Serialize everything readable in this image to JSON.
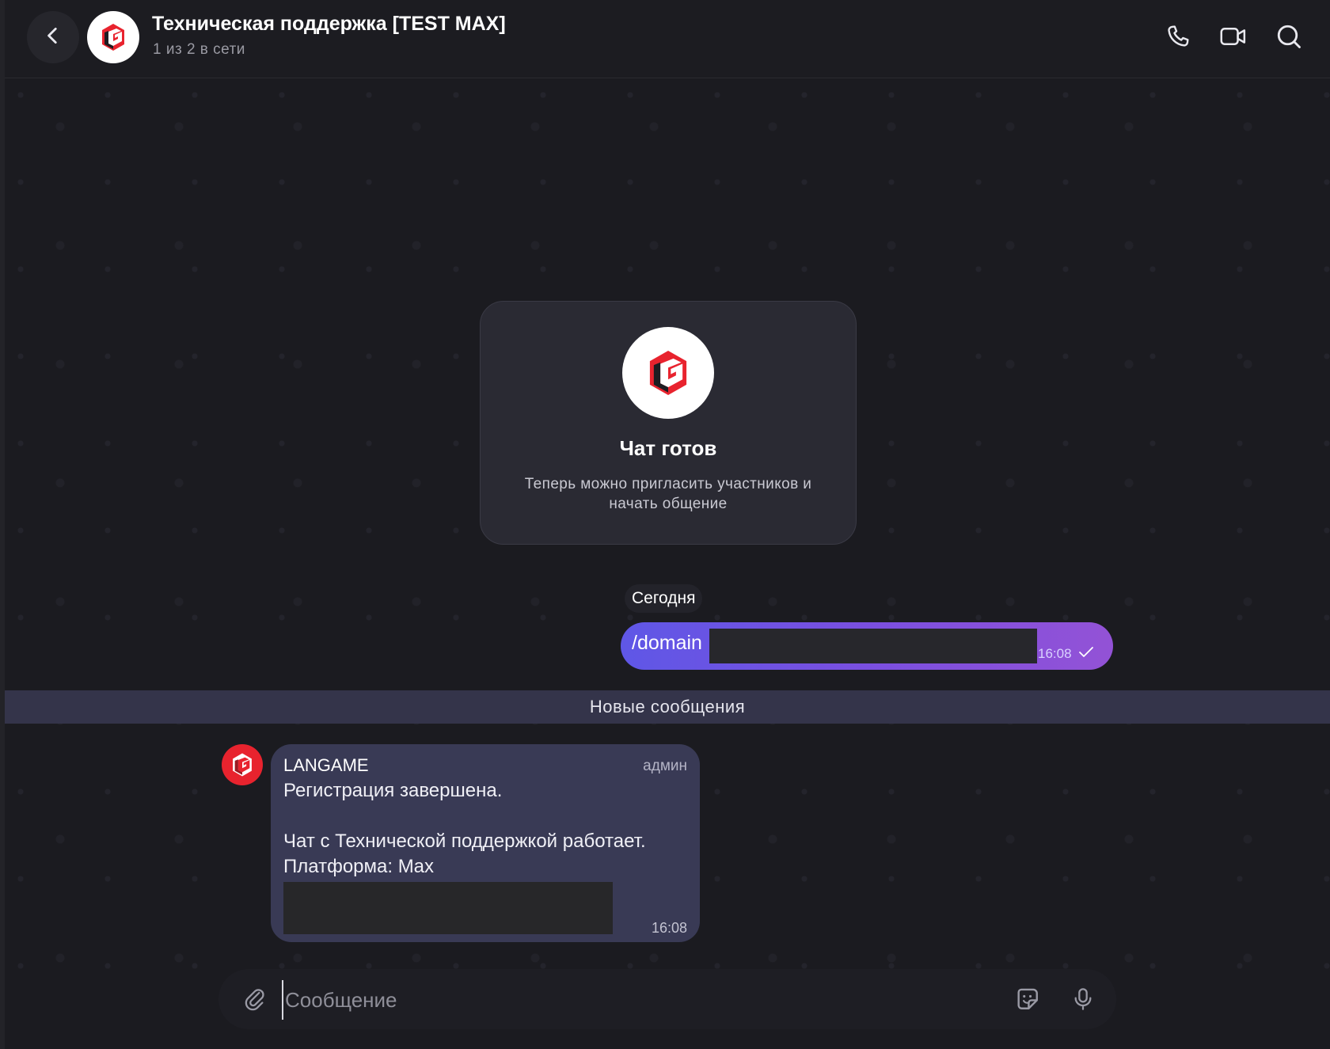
{
  "header": {
    "title": "Техническая поддержка [TEST MAX]",
    "subtitle": "1 из 2 в сети",
    "icons": [
      "back-icon",
      "phone-icon",
      "video-icon",
      "search-icon"
    ]
  },
  "system_card": {
    "title": "Чат готов",
    "text": "Теперь можно пригласить участников и начать общение"
  },
  "date_separator": "Сегодня",
  "outgoing_message": {
    "text": "/domain",
    "time": "16:08",
    "status": "sent"
  },
  "new_messages_label": "Новые сообщения",
  "incoming_message": {
    "sender": "LANGAME",
    "role": "админ",
    "body": "Регистрация завершена.\n\nЧат с Технической поддержкой работает.\nПлатформа: Max",
    "time": "16:08"
  },
  "composer": {
    "placeholder": "Сообщение",
    "icons": [
      "attach-icon",
      "sticker-icon",
      "microphone-icon"
    ]
  },
  "colors": {
    "accent_gradient_start": "#5f57e6",
    "accent_gradient_end": "#9352d6",
    "logo_red": "#e8232e",
    "incoming_bubble": "#393a55"
  }
}
